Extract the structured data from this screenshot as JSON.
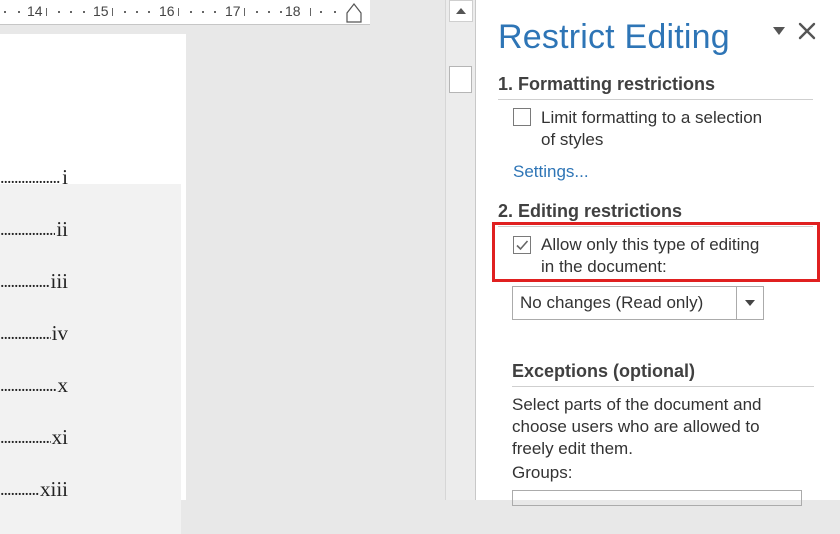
{
  "ruler": {
    "numbers": [
      "14",
      "15",
      "16",
      "17",
      "18"
    ]
  },
  "toc": {
    "numerals": [
      "i",
      "ii",
      "iii",
      "iv",
      "x",
      "xi",
      "xiii"
    ]
  },
  "pane": {
    "title": "Restrict Editing",
    "formatting": {
      "heading": "1. Formatting restrictions",
      "limit_line1": "Limit formatting to a selection",
      "limit_line2": "of styles",
      "limit_checked": false,
      "settings_link": "Settings..."
    },
    "editing": {
      "heading": "2. Editing restrictions",
      "allow_line1": "Allow only this type of editing",
      "allow_line2": "in the document:",
      "allow_checked": true,
      "selected_option": "No changes (Read only)"
    },
    "exceptions": {
      "heading": "Exceptions (optional)",
      "desc_line1": "Select parts of the document and",
      "desc_line2": "choose users who are allowed to",
      "desc_line3": "freely edit them.",
      "groups_label": "Groups:"
    }
  },
  "colors": {
    "accent": "#2e75b6",
    "highlight": "#e02020"
  }
}
